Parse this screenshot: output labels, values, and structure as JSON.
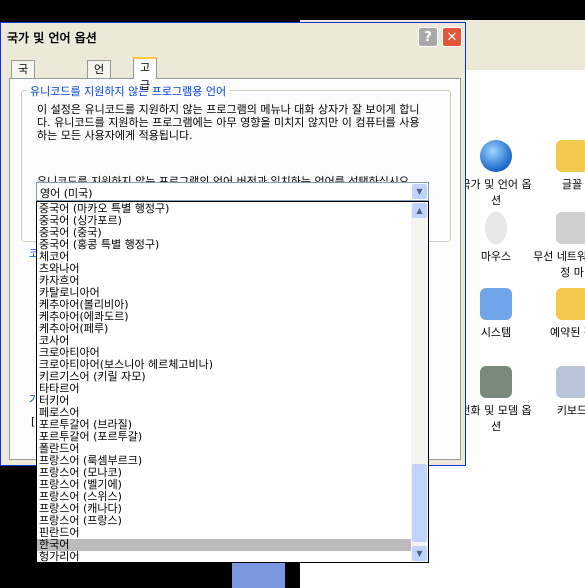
{
  "control_panel": {
    "tiles": [
      {
        "label": "국가 및 언어 옵션",
        "icon": "globe-icon"
      },
      {
        "label": "글꼴",
        "icon": "fonts-folder-icon"
      },
      {
        "label": "마우스",
        "icon": "mouse-icon"
      },
      {
        "label": "무선 네트워크 설정 마",
        "icon": "wireless-network-icon"
      },
      {
        "label": "시스템",
        "icon": "system-icon"
      },
      {
        "label": "예약된 작",
        "icon": "scheduled-tasks-icon"
      },
      {
        "label": "전화 및 모뎀 옵션",
        "icon": "phone-modem-icon"
      },
      {
        "label": "키보드",
        "icon": "keyboard-icon"
      }
    ]
  },
  "dialog": {
    "title": "국가 및 언어 옵션",
    "help_label": "?",
    "close_label": "✕",
    "tabs": [
      "국가별 옵션",
      "언어",
      "고급"
    ],
    "active_tab": 2,
    "group_title": "유니코드를 지원하지 않는 프로그램용 언어",
    "description": "이 설정은 유니코드를 지원하지 않는 프로그램의 메뉴나 대화 상자가 잘 보이게 합니다. 유니코드를 지원하는 프로그램에는 아무 영향을 미치지 않지만 이 컴퓨터를 사용하는 모든 사용자에게 적용됩니다.",
    "prompt": "유니코드를 지원하지 않는 프로그램의 언어 버전과 일치하는 언어를 선택하십시오(S).",
    "combo_value": "영어 (미국)",
    "ghost_text_1": "코",
    "ghost_text_2": "기",
    "ghost_text_3": "[",
    "list_items": [
      "중국어 (마카오 특별 행정구)",
      "중국어 (싱가포르)",
      "중국어 (중국)",
      "중국어 (홍콩 특별 행정구)",
      "체코어",
      "츠와나어",
      "카자흐어",
      "카탈로니아어",
      "케추아어(볼리비아)",
      "케추아어(에콰도르)",
      "케추아어(페루)",
      "코사어",
      "크로아티아어",
      "크로아티아어(보스니아 헤르체고비나)",
      "키르기스어 (키릴 자모)",
      "타타르어",
      "터키어",
      "페로스어",
      "포르투갈어 (브라질)",
      "포르투갈어 (포르투갈)",
      "폴란드어",
      "프랑스어 (룩셈부르크)",
      "프랑스어 (모나코)",
      "프랑스어 (벨기에)",
      "프랑스어 (스위스)",
      "프랑스어 (캐나다)",
      "프랑스어 (프랑스)",
      "핀란드어",
      "한국어",
      "헝가리어"
    ],
    "selected_index": 28
  },
  "colors": {
    "title_border": "#0831d9",
    "close": "#e2573a",
    "group_title": "#0046d5",
    "tab_highlight": "#ffc83c"
  }
}
